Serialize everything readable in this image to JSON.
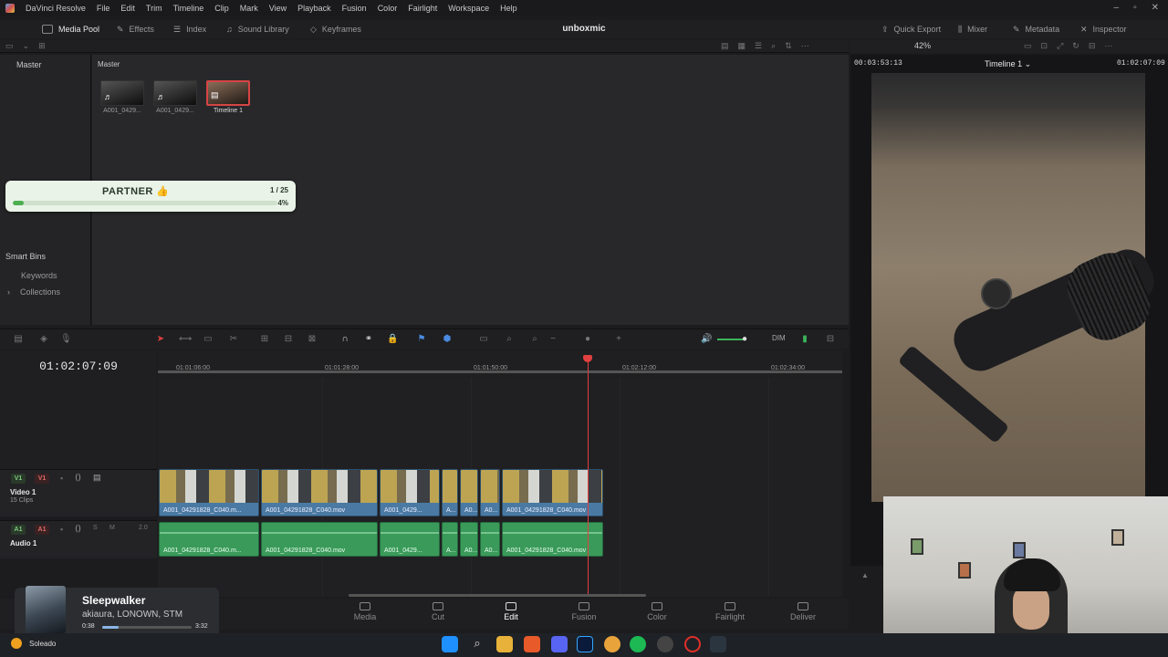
{
  "app": {
    "name": "DaVinci Resolve",
    "menu": [
      "File",
      "Edit",
      "Trim",
      "Timeline",
      "Clip",
      "Mark",
      "View",
      "Playback",
      "Fusion",
      "Color",
      "Fairlight",
      "Workspace",
      "Help"
    ]
  },
  "toolbar": {
    "media_pool": "Media Pool",
    "effects": "Effects",
    "index": "Index",
    "sound_library": "Sound Library",
    "keyframes": "Keyframes",
    "project_title": "unboxmic",
    "quick_export": "Quick Export",
    "mixer": "Mixer",
    "metadata": "Metadata",
    "inspector": "Inspector"
  },
  "viewer_bar": {
    "zoom": "42%"
  },
  "bins": {
    "master": "Master",
    "master_header": "Master"
  },
  "clips": [
    {
      "caption": "A001_0429...",
      "icon": "audio-note-icon",
      "selected": false
    },
    {
      "caption": "A001_0429...",
      "icon": "audio-note-icon",
      "selected": false
    },
    {
      "caption": "Timeline 1",
      "icon": "timeline-icon",
      "selected": true
    }
  ],
  "partner": {
    "title": "PARTNER 👍",
    "count": "1 / 25",
    "percent": "4%",
    "progress": 0.04
  },
  "smart_bins": {
    "title": "Smart Bins",
    "keywords": "Keywords",
    "collections": "Collections"
  },
  "edit_tools": {
    "dim": "DIM"
  },
  "timeline": {
    "timecode": "01:02:07:09",
    "ruler_ticks": [
      "01:01:06:00",
      "01:01:28:00",
      "01:01:50:00",
      "01:02:12:00",
      "01:02:34:00"
    ],
    "video_track": {
      "badge1": "V1",
      "badge2": "V1",
      "name": "Video 1",
      "sub": "15 Clips"
    },
    "audio_track": {
      "badge1": "A1",
      "badge2": "A1",
      "solo": "S",
      "mute": "M",
      "channels": "2.0",
      "name": "Audio 1"
    },
    "video_clips": [
      {
        "label": "A001_04291828_C040.m..."
      },
      {
        "label": "A001_04291828_C040.mov"
      },
      {
        "label": "A001_0429..."
      },
      {
        "label": "A..."
      },
      {
        "label": "A0..."
      },
      {
        "label": "A0..."
      },
      {
        "label": "A001_04291828_C040.mov"
      }
    ],
    "audio_clips": [
      {
        "label": "A001_04291828_C040.m..."
      },
      {
        "label": "A001_04291828_C040.mov"
      },
      {
        "label": "A001_0429..."
      },
      {
        "label": "A..."
      },
      {
        "label": "A0..."
      },
      {
        "label": "A0..."
      },
      {
        "label": "A001_04291828_C040.mov"
      }
    ]
  },
  "pages": [
    "Media",
    "Cut",
    "Edit",
    "Fusion",
    "Color",
    "Fairlight",
    "Deliver"
  ],
  "active_page": "Edit",
  "viewer": {
    "tc_left": "00:03:53:13",
    "title": "Timeline 1 ⌄",
    "tc_right": "01:02:07:09"
  },
  "now_playing": {
    "title": "Sleepwalker",
    "artist": "akiaura, LONOWN, STM",
    "current": "0:38",
    "duration": "3:32",
    "progress": 0.18
  },
  "taskbar": {
    "weather": "Soleado"
  }
}
